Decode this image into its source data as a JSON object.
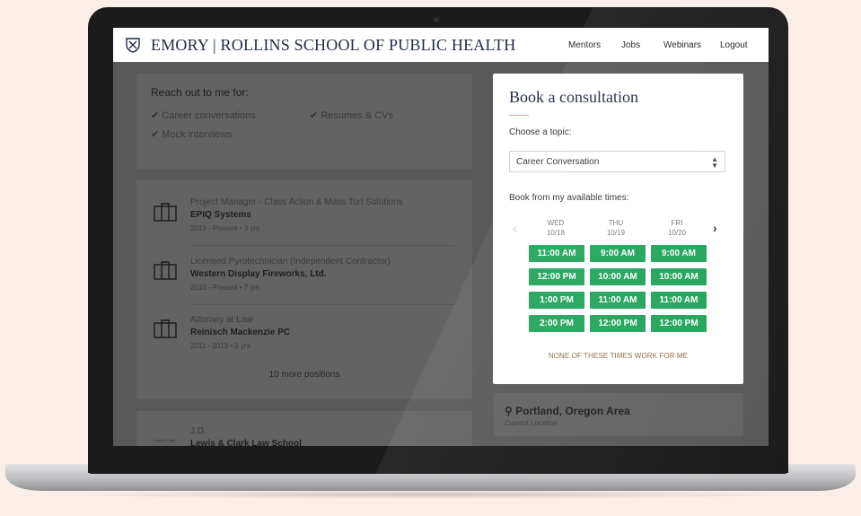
{
  "header": {
    "brand": "EMORY | ROLLINS SCHOOL OF PUBLIC HEALTH",
    "nav": [
      "Mentors",
      "Jobs",
      "Webinars",
      "Logout"
    ]
  },
  "reach_out": {
    "title": "Reach out to me for:",
    "items": [
      "Career conversations",
      "Resumes & CVs",
      "Mock interviews"
    ]
  },
  "experience": {
    "positions": [
      {
        "title": "Project Manager - Class Action & Mass Tort Solutions",
        "company": "EPIQ Systems",
        "dates": "2013 - Present • 3 yrs"
      },
      {
        "title": "Licensed Pyrotechnician (Independent Contractor)",
        "company": "Western Display Fireworks, Ltd.",
        "dates": "2010 - Present • 7 yrs"
      },
      {
        "title": "Attorney at Law",
        "company": "Reinisch Mackenzie PC",
        "dates": "2011 - 2013 • 2 yrs"
      }
    ],
    "more": "10 more positions"
  },
  "education": {
    "degree": "J.D.",
    "school": "Lewis & Clark Law School"
  },
  "location": {
    "icon": "map-pin-icon",
    "place": "Portland, Oregon Area",
    "label": "Current Location"
  },
  "booking": {
    "title": "Book a consultation",
    "topic_label": "Choose a topic:",
    "topic_value": "Career Conversation",
    "times_label": "Book from my available times:",
    "days": [
      {
        "dow": "WED",
        "date": "10/18",
        "slots": [
          "11:00 AM",
          "12:00 PM",
          "1:00 PM",
          "2:00 PM"
        ]
      },
      {
        "dow": "THU",
        "date": "10/19",
        "slots": [
          "9:00 AM",
          "10:00 AM",
          "11:00 AM",
          "12:00 PM"
        ]
      },
      {
        "dow": "FRI",
        "date": "10/20",
        "slots": [
          "9:00 AM",
          "10:00 AM",
          "11:00 AM",
          "12:00 PM"
        ]
      }
    ],
    "none_label": "NONE OF THESE TIMES WORK FOR ME"
  },
  "colors": {
    "slot_green": "#23a55c",
    "brand_navy": "#1f2b45",
    "accent_rule": "#e9a48a"
  }
}
